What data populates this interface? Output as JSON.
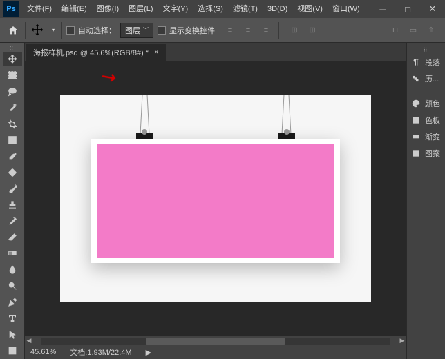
{
  "app": {
    "logo": "Ps"
  },
  "menu": [
    "文件(F)",
    "编辑(E)",
    "图像(I)",
    "图层(L)",
    "文字(Y)",
    "选择(S)",
    "滤镜(T)",
    "3D(D)",
    "视图(V)",
    "窗口(W)"
  ],
  "options": {
    "auto_select_label": "自动选择：",
    "auto_select_value": "图层",
    "transform_controls": "显示变换控件"
  },
  "doc_tab": {
    "title": "海报样机.psd @ 45.6%(RGB/8#) *",
    "close": "×"
  },
  "status": {
    "zoom": "45.61%",
    "doc_label": "文档:",
    "doc_size": "1.93M/22.4M",
    "arrow": "▶"
  },
  "panels": [
    "段落",
    "历...",
    "颜色",
    "色板",
    "渐变",
    "图案"
  ]
}
